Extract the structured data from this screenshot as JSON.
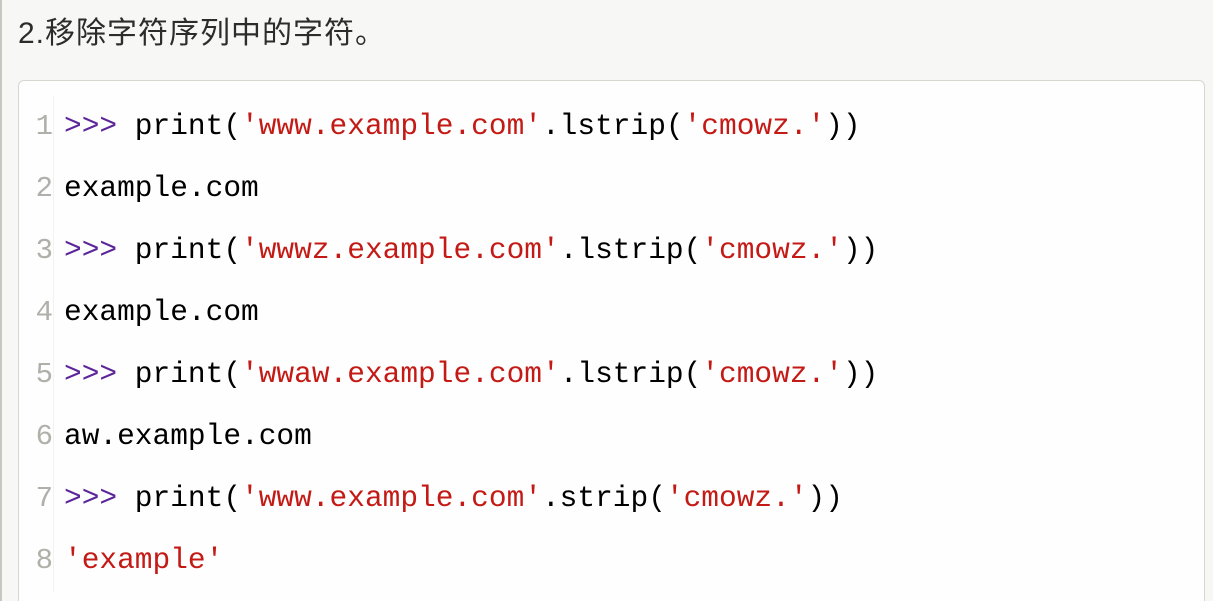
{
  "heading": "2.移除字符序列中的字符。",
  "code": {
    "lines": [
      {
        "n": "1",
        "segments": [
          {
            "cls": "p",
            "t": ">>>"
          },
          {
            "cls": "",
            "t": " print("
          },
          {
            "cls": "s",
            "t": "'www.example.com'"
          },
          {
            "cls": "",
            "t": ".lstrip("
          },
          {
            "cls": "s",
            "t": "'cmowz.'"
          },
          {
            "cls": "",
            "t": "))"
          }
        ]
      },
      {
        "n": "2",
        "segments": [
          {
            "cls": "",
            "t": "example.com"
          }
        ]
      },
      {
        "n": "3",
        "segments": [
          {
            "cls": "p",
            "t": ">>>"
          },
          {
            "cls": "",
            "t": " print("
          },
          {
            "cls": "s",
            "t": "'wwwz.example.com'"
          },
          {
            "cls": "",
            "t": ".lstrip("
          },
          {
            "cls": "s",
            "t": "'cmowz.'"
          },
          {
            "cls": "",
            "t": "))"
          }
        ]
      },
      {
        "n": "4",
        "segments": [
          {
            "cls": "",
            "t": "example.com"
          }
        ]
      },
      {
        "n": "5",
        "segments": [
          {
            "cls": "p",
            "t": ">>>"
          },
          {
            "cls": "",
            "t": " print("
          },
          {
            "cls": "s",
            "t": "'wwaw.example.com'"
          },
          {
            "cls": "",
            "t": ".lstrip("
          },
          {
            "cls": "s",
            "t": "'cmowz.'"
          },
          {
            "cls": "",
            "t": "))"
          }
        ]
      },
      {
        "n": "6",
        "segments": [
          {
            "cls": "",
            "t": "aw.example.com"
          }
        ]
      },
      {
        "n": "7",
        "segments": [
          {
            "cls": "p",
            "t": ">>>"
          },
          {
            "cls": "",
            "t": " print("
          },
          {
            "cls": "s",
            "t": "'www.example.com'"
          },
          {
            "cls": "",
            "t": ".strip("
          },
          {
            "cls": "s",
            "t": "'cmowz.'"
          },
          {
            "cls": "",
            "t": "))"
          }
        ]
      },
      {
        "n": "8",
        "segments": [
          {
            "cls": "s",
            "t": "'example'"
          }
        ]
      }
    ]
  }
}
